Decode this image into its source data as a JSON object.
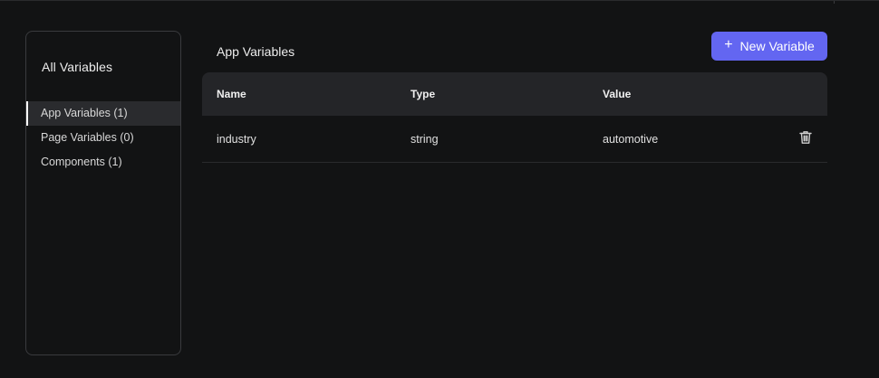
{
  "sidebar": {
    "title": "All Variables",
    "items": [
      {
        "label": "App Variables (1)",
        "active": true
      },
      {
        "label": "Page Variables (0)",
        "active": false
      },
      {
        "label": "Components (1)",
        "active": false
      }
    ]
  },
  "main": {
    "title": "App Variables",
    "new_button_label": "New Variable",
    "new_button_icon": "plus-icon",
    "table": {
      "headers": {
        "name": "Name",
        "type": "Type",
        "value": "Value"
      },
      "rows": [
        {
          "name": "industry",
          "type": "string",
          "value": "automotive",
          "action_icon": "trash-icon"
        }
      ]
    }
  },
  "colors": {
    "background": "#121314",
    "accent": "#6366f1",
    "header_bg": "#242528",
    "active_item_bg": "#2a2b2e"
  }
}
